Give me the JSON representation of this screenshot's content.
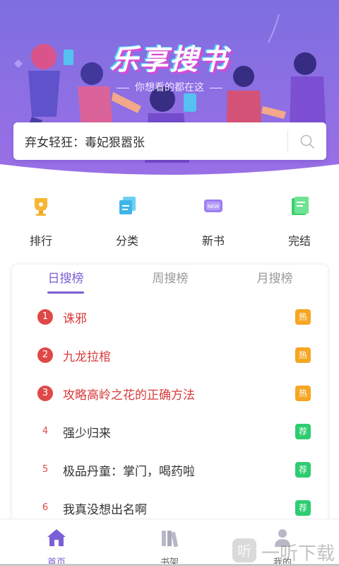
{
  "app": {
    "logo_text": "乐享搜书",
    "slogan": "你想看的都在这"
  },
  "search": {
    "value": "弃女轻狂：毒妃狠嚣张"
  },
  "categories": [
    {
      "label": "排行",
      "icon": "trophy-icon"
    },
    {
      "label": "分类",
      "icon": "stack-icon"
    },
    {
      "label": "新书",
      "icon": "new-book-icon"
    },
    {
      "label": "完结",
      "icon": "finished-book-icon"
    }
  ],
  "tabs": [
    {
      "label": "日搜榜",
      "active": true
    },
    {
      "label": "周搜榜",
      "active": false
    },
    {
      "label": "月搜榜",
      "active": false
    }
  ],
  "ranking": [
    {
      "rank": "1",
      "title": "诛邪",
      "badge": "热"
    },
    {
      "rank": "2",
      "title": "九龙拉棺",
      "badge": "热"
    },
    {
      "rank": "3",
      "title": "攻略高岭之花的正确方法",
      "badge": "热"
    },
    {
      "rank": "4",
      "title": "强少归来",
      "badge": "荐"
    },
    {
      "rank": "5",
      "title": "极品丹童：掌门，喝药啦",
      "badge": "荐"
    },
    {
      "rank": "6",
      "title": "我真没想出名啊",
      "badge": "荐"
    }
  ],
  "bottom_nav": [
    {
      "label": "首页",
      "icon": "home-icon",
      "active": true
    },
    {
      "label": "书架",
      "icon": "bookshelf-icon",
      "active": false
    },
    {
      "label": "我的",
      "icon": "user-icon",
      "active": false
    }
  ],
  "watermark": {
    "text": "一听下载"
  },
  "colors": {
    "accent": "#7b5fd6",
    "header_top": "#7e6fe0",
    "header_bottom": "#9f6fe8",
    "hot_red": "#e04848",
    "hot_badge": "#f5a623",
    "recommend_badge": "#2ecc71"
  }
}
